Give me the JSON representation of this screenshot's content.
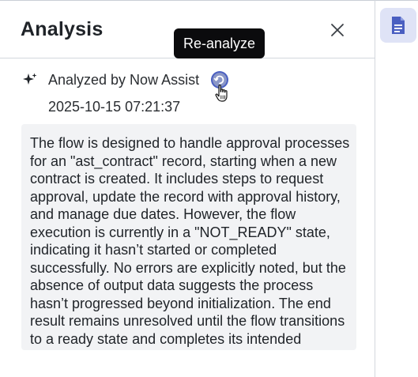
{
  "panel": {
    "title": "Analysis",
    "close_icon": "close-icon"
  },
  "tooltip": {
    "text": "Re-analyze"
  },
  "analysis": {
    "source_label": "Analyzed by Now Assist",
    "timestamp": "2025-10-15 07:21:37",
    "summary": "The flow is designed to handle approval processes for an \"ast_contract\" record, starting when a new contract is created. It includes steps to request approval, update the record with approval history, and manage due dates. However, the flow execution is currently in a \"NOT_READY\" state, indicating it hasn’t started or completed successfully. No errors are explicitly noted, but the absence of output data suggests the process hasn’t progressed beyond initialization. The end result remains unresolved until the flow transitions to a ready state and completes its intended actions."
  },
  "side_rail": {
    "active_icon": "document-icon"
  },
  "colors": {
    "accent": "#4a5fc1",
    "rail_active_bg": "#dfe3f6",
    "summary_bg": "#f2f3f5",
    "tooltip_bg": "#0b0b0d"
  }
}
